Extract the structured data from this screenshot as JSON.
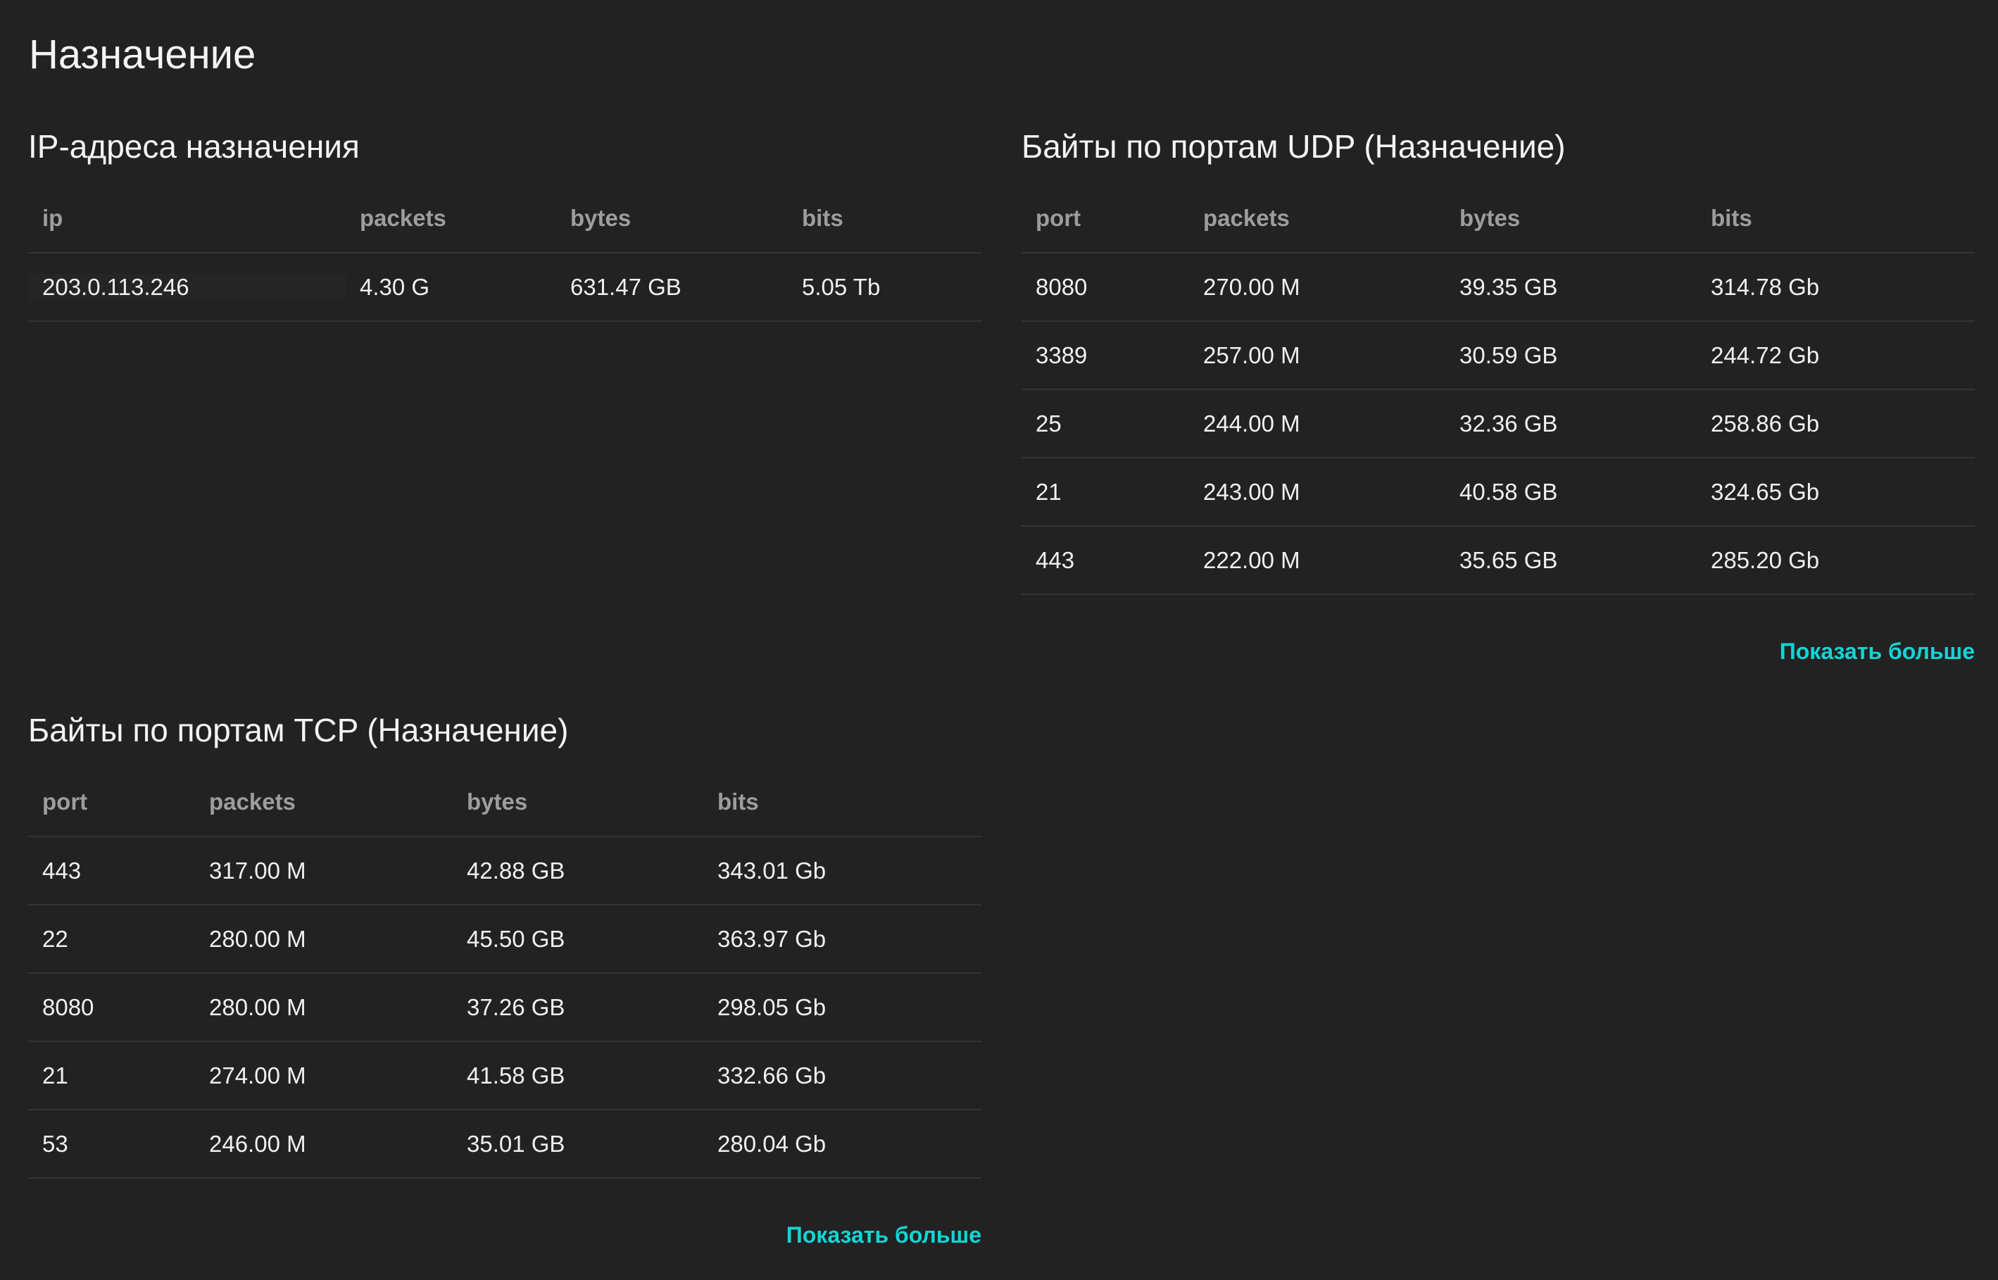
{
  "page": {
    "title": "Назначение"
  },
  "ip_panel": {
    "title": "IP-адреса назначения",
    "columns": [
      "ip",
      "packets",
      "bytes",
      "bits"
    ],
    "rows": [
      [
        "203.0.113.246",
        "4.30 G",
        "631.47 GB",
        "5.05 Tb"
      ]
    ]
  },
  "udp_panel": {
    "title": "Байты по портам UDP (Назначение)",
    "columns": [
      "port",
      "packets",
      "bytes",
      "bits"
    ],
    "rows": [
      [
        "8080",
        "270.00 M",
        "39.35 GB",
        "314.78 Gb"
      ],
      [
        "3389",
        "257.00 M",
        "30.59 GB",
        "244.72 Gb"
      ],
      [
        "25",
        "244.00 M",
        "32.36 GB",
        "258.86 Gb"
      ],
      [
        "21",
        "243.00 M",
        "40.58 GB",
        "324.65 Gb"
      ],
      [
        "443",
        "222.00 M",
        "35.65 GB",
        "285.20 Gb"
      ]
    ],
    "show_more_label": "Показать больше"
  },
  "tcp_panel": {
    "title": "Байты по портам TCP (Назначение)",
    "columns": [
      "port",
      "packets",
      "bytes",
      "bits"
    ],
    "rows": [
      [
        "443",
        "317.00 M",
        "42.88 GB",
        "343.01 Gb"
      ],
      [
        "22",
        "280.00 M",
        "45.50 GB",
        "363.97 Gb"
      ],
      [
        "8080",
        "280.00 M",
        "37.26 GB",
        "298.05 Gb"
      ],
      [
        "21",
        "274.00 M",
        "41.58 GB",
        "332.66 Gb"
      ],
      [
        "53",
        "246.00 M",
        "35.01 GB",
        "280.04 Gb"
      ]
    ],
    "show_more_label": "Показать больше"
  },
  "colors": {
    "background": "#222222",
    "text": "#f0f0f0",
    "header_text": "#9d9d9d",
    "accent": "#14d4d4",
    "divider": "#343434"
  }
}
